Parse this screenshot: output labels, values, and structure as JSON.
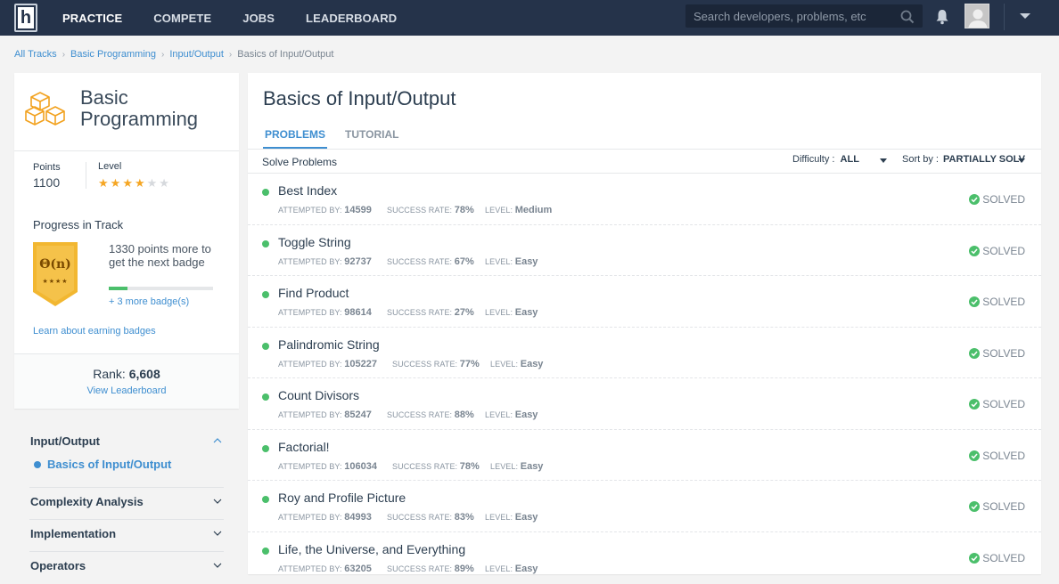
{
  "nav": {
    "logo_letter": "h",
    "links": [
      "PRACTICE",
      "COMPETE",
      "JOBS",
      "LEADERBOARD"
    ],
    "active": "PRACTICE",
    "search_placeholder": "Search developers, problems, etc"
  },
  "breadcrumb": [
    "All Tracks",
    "Basic Programming",
    "Input/Output",
    "Basics of Input/Output"
  ],
  "track": {
    "title": "Basic Programming",
    "points_label": "Points",
    "points_value": "1100",
    "level_label": "Level",
    "level_stars": 4,
    "level_max": 6,
    "progress_title": "Progress in Track",
    "badge_symbol": "Θ(n)",
    "badge_stars": "★★★★",
    "badge_text": "1330 points more to get the next badge",
    "badge_progress": 0.18,
    "more_badges": "+ 3 more badge(s)",
    "learn_badges": "Learn about earning badges",
    "rank_label": "Rank:",
    "rank_value": "6,608",
    "view_leaderboard": "View Leaderboard"
  },
  "topics": [
    {
      "label": "Input/Output",
      "open": true,
      "sub": "Basics of Input/Output"
    },
    {
      "label": "Complexity Analysis"
    },
    {
      "label": "Implementation"
    },
    {
      "label": "Operators"
    }
  ],
  "main": {
    "title": "Basics of Input/Output",
    "tabs": [
      "PROBLEMS",
      "TUTORIAL"
    ],
    "solve_label": "Solve Problems",
    "difficulty_label": "Difficulty :",
    "difficulty_value": "ALL",
    "sort_label": "Sort by :",
    "sort_value": "PARTIALLY SOLVED"
  },
  "problem_labels": {
    "attempted": "ATTEMPTED BY:",
    "success": "SUCCESS RATE:",
    "level": "LEVEL:",
    "status": "SOLVED"
  },
  "problems": [
    {
      "name": "Best Index",
      "attempted": "14599",
      "success": "78%",
      "level": "Medium"
    },
    {
      "name": "Toggle String",
      "attempted": "92737",
      "success": "67%",
      "level": "Easy"
    },
    {
      "name": "Find Product",
      "attempted": "98614",
      "success": "27%",
      "level": "Easy"
    },
    {
      "name": "Palindromic String",
      "attempted": "105227",
      "success": "77%",
      "level": "Easy"
    },
    {
      "name": "Count Divisors",
      "attempted": "85247",
      "success": "88%",
      "level": "Easy"
    },
    {
      "name": "Factorial!",
      "attempted": "106034",
      "success": "78%",
      "level": "Easy"
    },
    {
      "name": "Roy and Profile Picture",
      "attempted": "84993",
      "success": "83%",
      "level": "Easy"
    },
    {
      "name": "Life, the Universe, and Everything",
      "attempted": "63205",
      "success": "89%",
      "level": "Easy"
    }
  ],
  "colors": {
    "nav_bg": "#25334a",
    "accent": "#3e8ed0",
    "solved_green": "#4bbf6b",
    "star": "#f5a623",
    "badge_gold": "#f2b731"
  }
}
